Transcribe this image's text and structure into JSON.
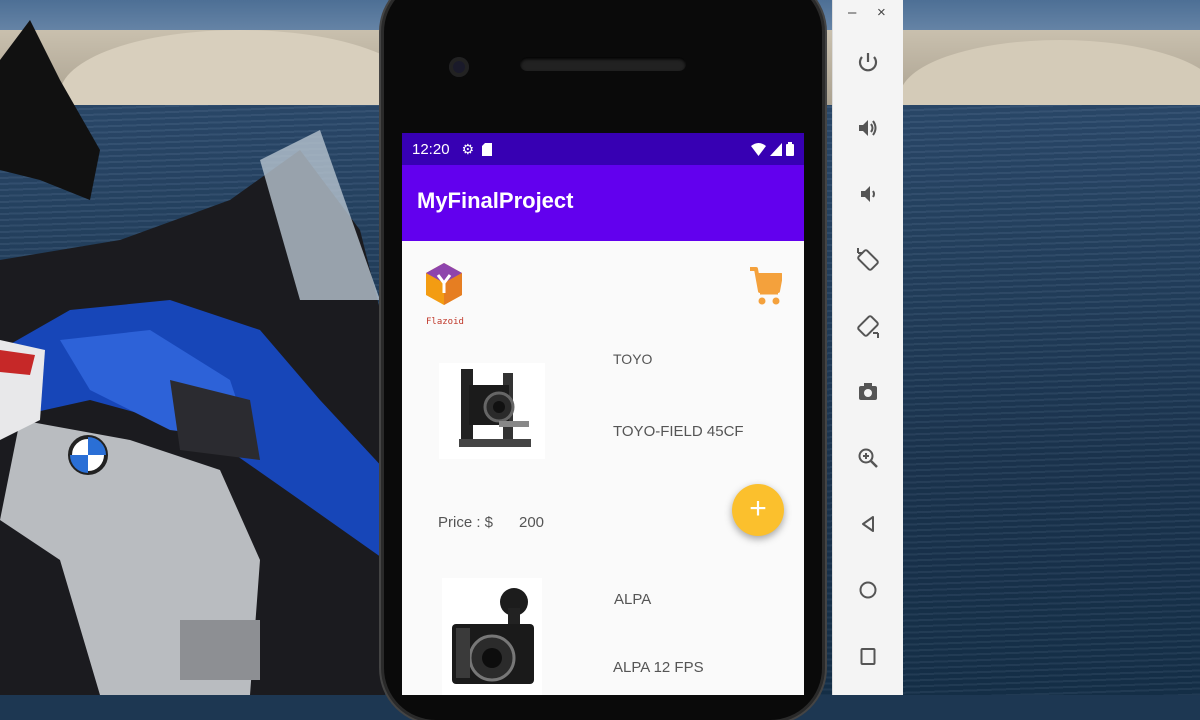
{
  "emulator": {
    "minimize_label": "–",
    "close_label": "×",
    "tools": [
      "power-icon",
      "volume-up-icon",
      "volume-down-icon",
      "rotate-left-icon",
      "rotate-right-icon",
      "camera-icon",
      "zoom-icon",
      "back-icon",
      "home-icon",
      "overview-icon"
    ]
  },
  "status_bar": {
    "time": "12:20"
  },
  "app": {
    "title": "MyFinalProject",
    "logo_text": "Flazoid"
  },
  "products": [
    {
      "brand": "TOYO",
      "model": "TOYO-FIELD 45CF",
      "price_label": "Price : $",
      "price": "200"
    },
    {
      "brand": "ALPA",
      "model": "ALPA 12 FPS"
    }
  ],
  "fab_label": "+",
  "colors": {
    "status_bar": "#3700b3",
    "app_bar": "#6200ee",
    "fab": "#fbc02d",
    "cart": "#f4a13c"
  }
}
